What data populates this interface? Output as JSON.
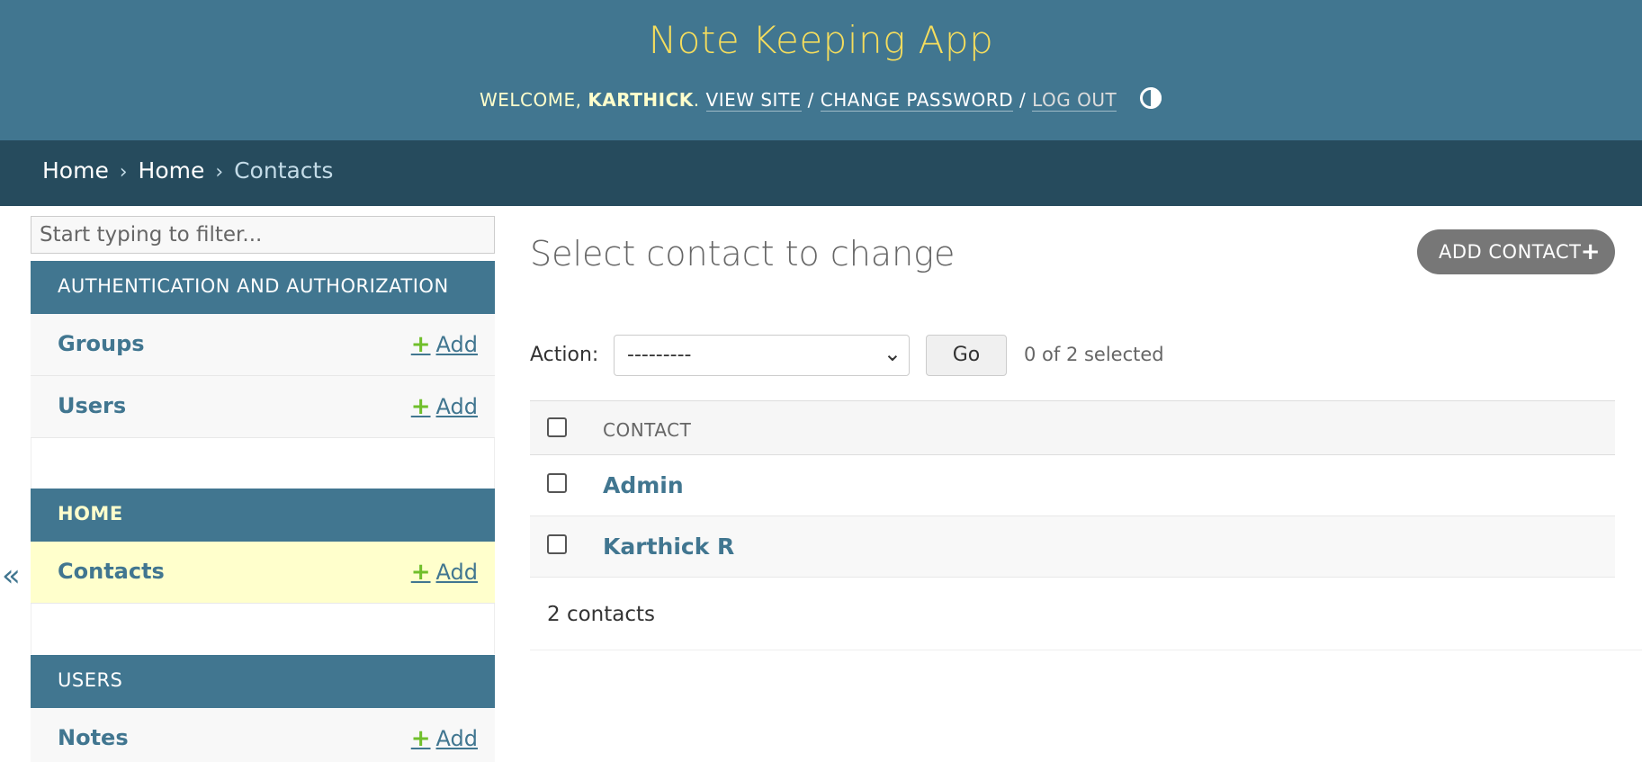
{
  "header": {
    "site_name": "Note Keeping App",
    "welcome": "Welcome, ",
    "username": "Karthick",
    "period": ".",
    "view_site": "View site",
    "change_password": "Change password",
    "log_out": "Log out",
    "separator": "/"
  },
  "breadcrumbs": {
    "items": [
      "Home",
      "Home",
      "Contacts"
    ],
    "separator": "›"
  },
  "sidebar": {
    "collapse_label": "«",
    "filter_placeholder": "Start typing to filter...",
    "add_label": "Add",
    "add_symbol": "+",
    "modules": [
      {
        "caption": "Authentication and Authorization",
        "models": [
          "Groups",
          "Users"
        ]
      },
      {
        "caption": "Home",
        "models": [
          "Contacts"
        ]
      },
      {
        "caption": "Users",
        "models": [
          "Notes"
        ]
      }
    ]
  },
  "content": {
    "title": "Select contact to change",
    "add_button": "Add contact",
    "add_button_symbol": "+",
    "action_label": "Action:",
    "action_value": "---------",
    "go_label": "Go",
    "selection_count": "0 of 2 selected",
    "column_header": "Contact",
    "rows": [
      "Admin",
      "Karthick R"
    ],
    "paginator": "2 contacts"
  },
  "colors": {
    "header_bg": "#417690",
    "breadcrumb_bg": "#264b5d",
    "site_name": "#f5dd5d",
    "link": "#417690",
    "add_plus": "#70bf2b",
    "current_row": "#ffffcc"
  }
}
